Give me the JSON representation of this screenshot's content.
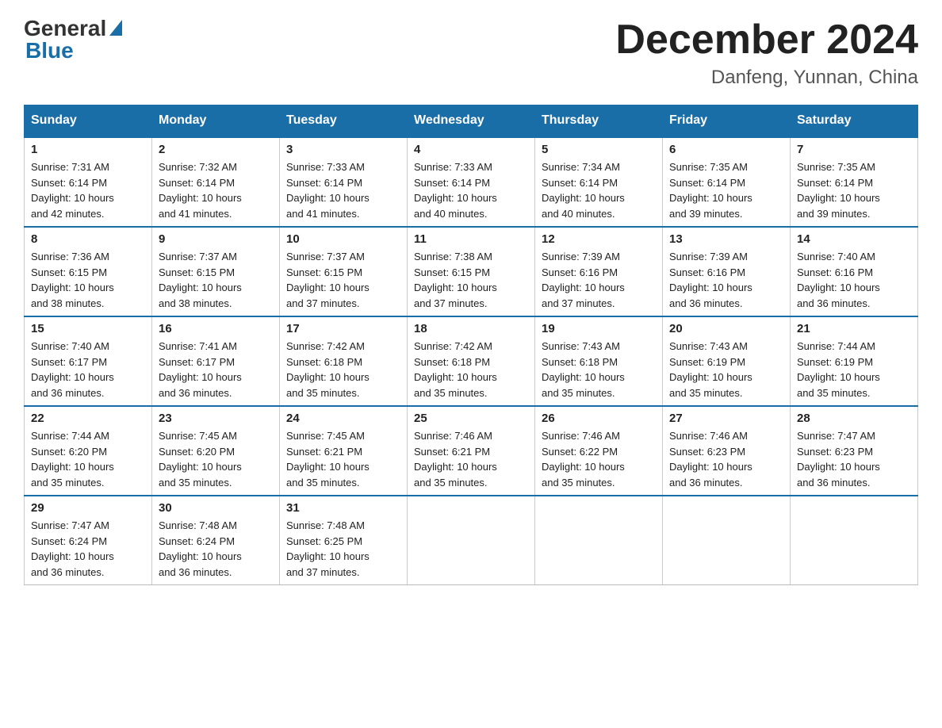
{
  "header": {
    "logo_general": "General",
    "logo_blue": "Blue",
    "month_year": "December 2024",
    "location": "Danfeng, Yunnan, China"
  },
  "days_of_week": [
    "Sunday",
    "Monday",
    "Tuesday",
    "Wednesday",
    "Thursday",
    "Friday",
    "Saturday"
  ],
  "weeks": [
    [
      {
        "num": "1",
        "sunrise": "7:31 AM",
        "sunset": "6:14 PM",
        "daylight": "10 hours and 42 minutes."
      },
      {
        "num": "2",
        "sunrise": "7:32 AM",
        "sunset": "6:14 PM",
        "daylight": "10 hours and 41 minutes."
      },
      {
        "num": "3",
        "sunrise": "7:33 AM",
        "sunset": "6:14 PM",
        "daylight": "10 hours and 41 minutes."
      },
      {
        "num": "4",
        "sunrise": "7:33 AM",
        "sunset": "6:14 PM",
        "daylight": "10 hours and 40 minutes."
      },
      {
        "num": "5",
        "sunrise": "7:34 AM",
        "sunset": "6:14 PM",
        "daylight": "10 hours and 40 minutes."
      },
      {
        "num": "6",
        "sunrise": "7:35 AM",
        "sunset": "6:14 PM",
        "daylight": "10 hours and 39 minutes."
      },
      {
        "num": "7",
        "sunrise": "7:35 AM",
        "sunset": "6:14 PM",
        "daylight": "10 hours and 39 minutes."
      }
    ],
    [
      {
        "num": "8",
        "sunrise": "7:36 AM",
        "sunset": "6:15 PM",
        "daylight": "10 hours and 38 minutes."
      },
      {
        "num": "9",
        "sunrise": "7:37 AM",
        "sunset": "6:15 PM",
        "daylight": "10 hours and 38 minutes."
      },
      {
        "num": "10",
        "sunrise": "7:37 AM",
        "sunset": "6:15 PM",
        "daylight": "10 hours and 37 minutes."
      },
      {
        "num": "11",
        "sunrise": "7:38 AM",
        "sunset": "6:15 PM",
        "daylight": "10 hours and 37 minutes."
      },
      {
        "num": "12",
        "sunrise": "7:39 AM",
        "sunset": "6:16 PM",
        "daylight": "10 hours and 37 minutes."
      },
      {
        "num": "13",
        "sunrise": "7:39 AM",
        "sunset": "6:16 PM",
        "daylight": "10 hours and 36 minutes."
      },
      {
        "num": "14",
        "sunrise": "7:40 AM",
        "sunset": "6:16 PM",
        "daylight": "10 hours and 36 minutes."
      }
    ],
    [
      {
        "num": "15",
        "sunrise": "7:40 AM",
        "sunset": "6:17 PM",
        "daylight": "10 hours and 36 minutes."
      },
      {
        "num": "16",
        "sunrise": "7:41 AM",
        "sunset": "6:17 PM",
        "daylight": "10 hours and 36 minutes."
      },
      {
        "num": "17",
        "sunrise": "7:42 AM",
        "sunset": "6:18 PM",
        "daylight": "10 hours and 35 minutes."
      },
      {
        "num": "18",
        "sunrise": "7:42 AM",
        "sunset": "6:18 PM",
        "daylight": "10 hours and 35 minutes."
      },
      {
        "num": "19",
        "sunrise": "7:43 AM",
        "sunset": "6:18 PM",
        "daylight": "10 hours and 35 minutes."
      },
      {
        "num": "20",
        "sunrise": "7:43 AM",
        "sunset": "6:19 PM",
        "daylight": "10 hours and 35 minutes."
      },
      {
        "num": "21",
        "sunrise": "7:44 AM",
        "sunset": "6:19 PM",
        "daylight": "10 hours and 35 minutes."
      }
    ],
    [
      {
        "num": "22",
        "sunrise": "7:44 AM",
        "sunset": "6:20 PM",
        "daylight": "10 hours and 35 minutes."
      },
      {
        "num": "23",
        "sunrise": "7:45 AM",
        "sunset": "6:20 PM",
        "daylight": "10 hours and 35 minutes."
      },
      {
        "num": "24",
        "sunrise": "7:45 AM",
        "sunset": "6:21 PM",
        "daylight": "10 hours and 35 minutes."
      },
      {
        "num": "25",
        "sunrise": "7:46 AM",
        "sunset": "6:21 PM",
        "daylight": "10 hours and 35 minutes."
      },
      {
        "num": "26",
        "sunrise": "7:46 AM",
        "sunset": "6:22 PM",
        "daylight": "10 hours and 35 minutes."
      },
      {
        "num": "27",
        "sunrise": "7:46 AM",
        "sunset": "6:23 PM",
        "daylight": "10 hours and 36 minutes."
      },
      {
        "num": "28",
        "sunrise": "7:47 AM",
        "sunset": "6:23 PM",
        "daylight": "10 hours and 36 minutes."
      }
    ],
    [
      {
        "num": "29",
        "sunrise": "7:47 AM",
        "sunset": "6:24 PM",
        "daylight": "10 hours and 36 minutes."
      },
      {
        "num": "30",
        "sunrise": "7:48 AM",
        "sunset": "6:24 PM",
        "daylight": "10 hours and 36 minutes."
      },
      {
        "num": "31",
        "sunrise": "7:48 AM",
        "sunset": "6:25 PM",
        "daylight": "10 hours and 37 minutes."
      },
      null,
      null,
      null,
      null
    ]
  ]
}
